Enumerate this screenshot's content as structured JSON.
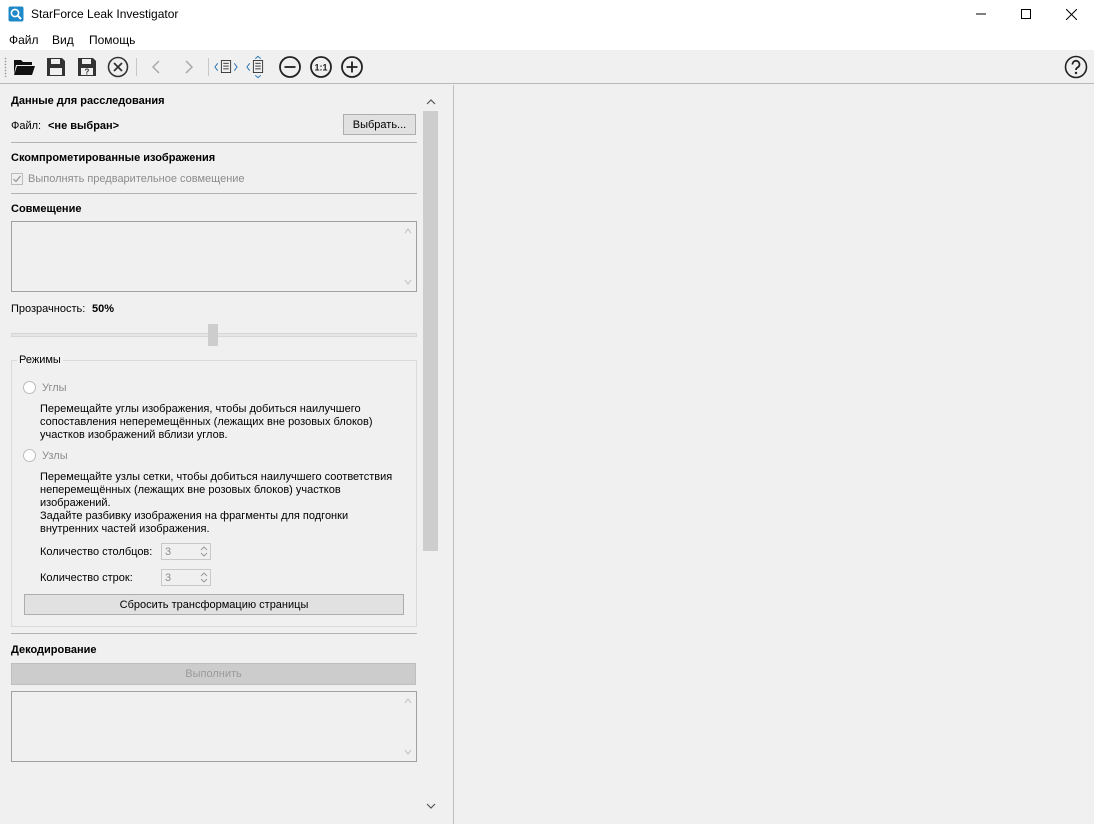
{
  "window": {
    "title": "StarForce Leak Investigator",
    "controls": [
      "minimize",
      "maximize",
      "close"
    ]
  },
  "menu": [
    "Файл",
    "Вид",
    "Помощь"
  ],
  "toolbar": {
    "icons": [
      "open-folder-icon",
      "save-icon",
      "save-as-icon",
      "close-doc-icon",
      "back-icon",
      "forward-icon",
      "prev-page-icon",
      "next-page-icon",
      "zoom-out-icon",
      "zoom-actual-icon",
      "zoom-in-icon",
      "help-icon"
    ],
    "zoom_actual_label": "1:1"
  },
  "investigation": {
    "title": "Данные для расследования",
    "file_label": "Файл:",
    "file_value": "<не выбран>",
    "choose_button": "Выбрать..."
  },
  "compromised": {
    "title": "Скомпрометированные изображения",
    "prealign_label": "Выполнять предварительное совмещение",
    "prealign_checked": true
  },
  "alignment": {
    "title": "Совмещение",
    "transparency_label": "Прозрачность:",
    "transparency_value": "50%",
    "transparency_level": 0.5
  },
  "modes": {
    "title": "Режимы",
    "corners_label": "Углы",
    "corners_desc": "Перемещайте углы изображения, чтобы добиться наилучшего сопоставления неперемещённых (лежащих вне розовых блоков) участков изображений вблизи углов.",
    "nodes_label": "Узлы",
    "nodes_desc": "Перемещайте узлы сетки, чтобы добиться наилучшего соответствия неперемещённых (лежащих вне розовых блоков) участков изображений.",
    "nodes_desc2": "Задайте разбивку изображения на фрагменты для подгонки внутренних частей изображения.",
    "columns_label": "Количество столбцов:",
    "columns_value": "3",
    "rows_label": "Количество строк:",
    "rows_value": "3",
    "reset_button": "Сбросить трансформацию страницы"
  },
  "decoding": {
    "title": "Декодирование",
    "run_button": "Выполнить"
  },
  "colors": {
    "accent": "#1f6fb2",
    "text_disabled": "#8c8c8c"
  }
}
